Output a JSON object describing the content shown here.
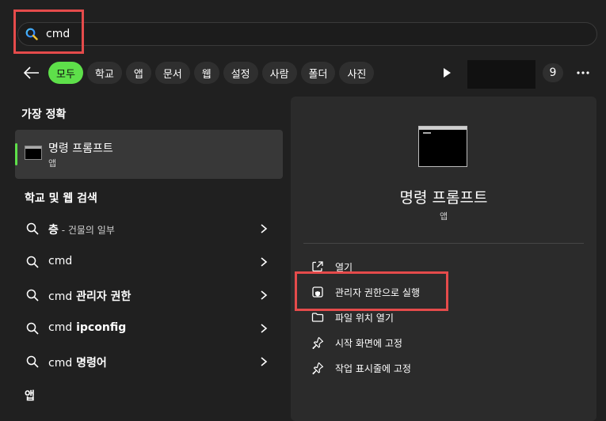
{
  "search": {
    "value": "cmd"
  },
  "filters": [
    {
      "label": "모두",
      "active": true
    },
    {
      "label": "학교",
      "active": false
    },
    {
      "label": "앱",
      "active": false
    },
    {
      "label": "문서",
      "active": false
    },
    {
      "label": "웹",
      "active": false
    },
    {
      "label": "설정",
      "active": false
    },
    {
      "label": "사람",
      "active": false
    },
    {
      "label": "폴더",
      "active": false
    },
    {
      "label": "사진",
      "active": false
    }
  ],
  "count_badge": "9",
  "best_match": {
    "section_label": "가장 정확",
    "name": "명령 프롬프트",
    "type": "앱"
  },
  "web_search": {
    "section_label": "학교 및 웹 검색",
    "results": [
      {
        "query": "층",
        "detail": " - 건물의 일부"
      },
      {
        "query": "cmd",
        "detail": ""
      },
      {
        "query": "cmd",
        "detail": " 관리자 권한"
      },
      {
        "query": "cmd",
        "detail": " ipconfig"
      },
      {
        "query": "cmd",
        "detail": " 명령어"
      }
    ]
  },
  "apps_section_label": "앱",
  "detail": {
    "name": "명령 프롬프트",
    "type": "앱",
    "actions": [
      {
        "label": "열기",
        "icon": "open-icon"
      },
      {
        "label": "관리자 권한으로 실행",
        "icon": "shield-icon"
      },
      {
        "label": "파일 위치 열기",
        "icon": "folder-icon"
      },
      {
        "label": "시작 화면에 고정",
        "icon": "pin-icon"
      },
      {
        "label": "작업 표시줄에 고정",
        "icon": "pin-icon"
      }
    ]
  },
  "colors": {
    "background": "#202020",
    "panel": "#2b2b2b",
    "accent": "#5ee04a",
    "highlight": "#e54b4b"
  }
}
